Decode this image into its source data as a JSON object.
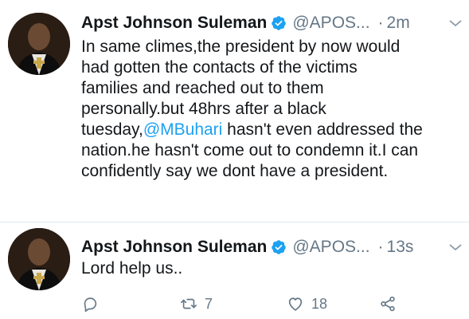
{
  "tweets": [
    {
      "author_name": "Apst Johnson Suleman",
      "handle": "@APOS...",
      "separator": "·",
      "time": "2m",
      "lines": [
        {
          "text": "In same climes,the president by now would"
        },
        {
          "text": "had gotten the contacts of the victims"
        },
        {
          "text": "families and reached out to them"
        },
        {
          "text": "personally.but 48hrs after a black"
        },
        {
          "prefix": "tuesday,",
          "mention": "@MBuhari",
          "suffix": " hasn't even addressed the"
        },
        {
          "text": "nation.he hasn't come out to condemn it.I can"
        },
        {
          "text": "confidently say we dont have a president."
        }
      ]
    },
    {
      "author_name": "Apst Johnson Suleman",
      "handle": "@APOS...",
      "separator": "·",
      "time": "13s",
      "lines": [
        {
          "text": "Lord help us.."
        }
      ],
      "actions": {
        "reply_icon": "reply-icon",
        "retweet_icon": "retweet-icon",
        "retweet_count": "7",
        "like_icon": "heart-icon",
        "like_count": "18",
        "share_icon": "share-icon"
      }
    }
  ],
  "colors": {
    "text": "#14171a",
    "secondary": "#657786",
    "link": "#1da1f2",
    "verified": "#1da1f2",
    "divider": "#e1e8ed"
  }
}
